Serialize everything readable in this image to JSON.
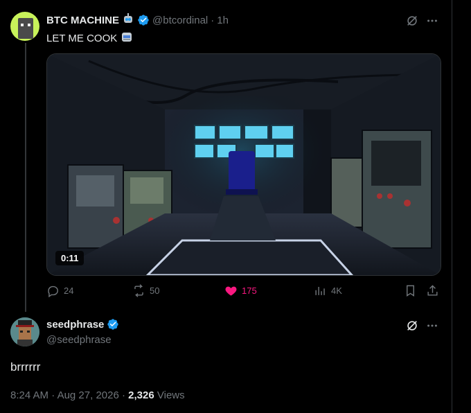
{
  "tweet": {
    "author_name": "BTC MACHINE",
    "author_handle": "@btcordinal",
    "separator": "·",
    "time_ago": "1h",
    "text": "LET ME COOK",
    "video_duration": "0:11",
    "actions": {
      "replies": "24",
      "reposts": "50",
      "likes": "175",
      "views": "4K"
    }
  },
  "reply": {
    "author_name": "seedphrase",
    "author_handle": "@seedphrase",
    "text": "brrrrrr",
    "time": "8:24 AM",
    "separator1": "·",
    "date": "Aug 27, 2026",
    "separator2": "·",
    "views_count": "2,326",
    "views_label": "Views"
  },
  "colors": {
    "background": "#000000",
    "text": "#e7e9ea",
    "muted": "#71767b",
    "verified": "#1d9bf0",
    "like": "#f91880",
    "border": "#2f3336"
  }
}
